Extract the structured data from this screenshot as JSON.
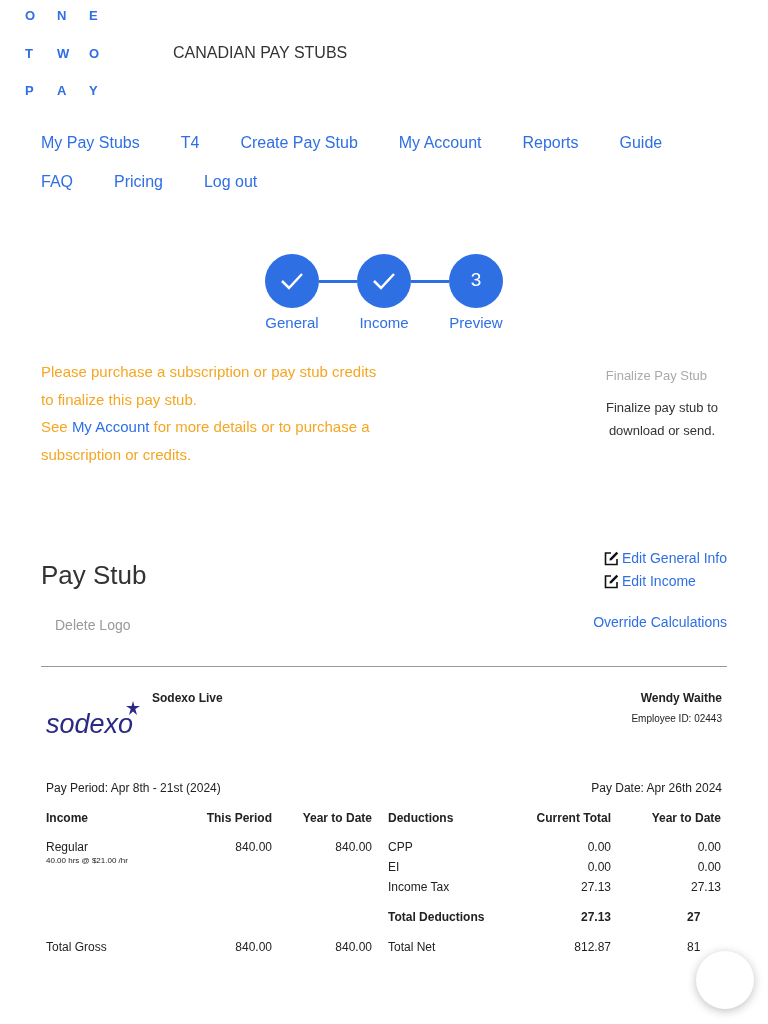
{
  "logo": {
    "letters": [
      "O",
      "N",
      "E",
      "T",
      "W",
      "O",
      "P",
      "A",
      "Y"
    ]
  },
  "site_title": "CANADIAN PAY STUBS",
  "nav": [
    "My Pay Stubs",
    "T4",
    "Create Pay Stub",
    "My Account",
    "Reports",
    "Guide",
    "FAQ",
    "Pricing",
    "Log out"
  ],
  "steps": [
    {
      "label": "General",
      "done": true
    },
    {
      "label": "Income",
      "done": true
    },
    {
      "label": "Preview",
      "done": false,
      "number": "3"
    }
  ],
  "notice": {
    "line_1": "Please purchase a subscription or pay stub credits to finalize this pay stub.",
    "before_link": "See",
    "link": "My Account",
    "after_link": "for more details or to purchase a subscription or credits."
  },
  "finalize": {
    "button": "Finalize Pay Stub",
    "disabled": true,
    "hint": "Finalize pay stub to download or send."
  },
  "pay_stub": {
    "heading": "Pay Stub",
    "delete_logo": "Delete Logo",
    "edit_links": [
      "Edit General Info",
      "Edit Income"
    ],
    "override": "Override Calculations"
  },
  "stub": {
    "company_logo_text": "sodexo",
    "company": "Sodexo Live",
    "employee": "Wendy Waithe",
    "employee_id": "Employee ID: 02443",
    "pay_period": "Pay Period: Apr 8th - 21st (2024)",
    "pay_date": "Pay Date: Apr 26th 2024",
    "income_columns": [
      "Income",
      "This Period",
      "Year to Date"
    ],
    "income_rows": [
      {
        "name": "Regular",
        "detail": "40.00 hrs @ $21.00 /hr",
        "this_period": "840.00",
        "ytd": "840.00"
      }
    ],
    "total_gross": {
      "name": "Total Gross",
      "this_period": "840.00",
      "ytd": "840.00"
    },
    "deduction_columns": [
      "Deductions",
      "Current Total",
      "Year to Date"
    ],
    "deduction_rows": [
      {
        "name": "CPP",
        "current": "0.00",
        "ytd": "0.00"
      },
      {
        "name": "EI",
        "current": "0.00",
        "ytd": "0.00"
      },
      {
        "name": "Income Tax",
        "current": "27.13",
        "ytd": "27.13"
      }
    ],
    "total_deductions": {
      "name": "Total Deductions",
      "current": "27.13",
      "ytd": "27"
    },
    "total_net": {
      "name": "Total Net",
      "current": "812.87",
      "ytd": "81"
    }
  }
}
